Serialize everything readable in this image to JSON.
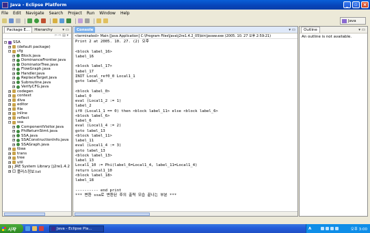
{
  "window": {
    "title": "Java - Eclipse Platform"
  },
  "menubar": [
    "File",
    "Edit",
    "Navigate",
    "Search",
    "Project",
    "Run",
    "Window",
    "Help"
  ],
  "perspective": {
    "label": "Java"
  },
  "package_explorer": {
    "tabs": [
      "Package E...",
      "Hierarchy"
    ],
    "tree": [
      {
        "label": "SSA",
        "icon": "project-icon",
        "indent": 0,
        "expanded": true
      },
      {
        "label": "(default package)",
        "icon": "package-icon",
        "indent": 1,
        "expanded": false
      },
      {
        "label": "cfg",
        "icon": "package-icon",
        "indent": 1,
        "expanded": true
      },
      {
        "label": "Block.java",
        "icon": "java-file-icon",
        "indent": 2,
        "expanded": false
      },
      {
        "label": "DominanceFrontier.java",
        "icon": "java-file-icon",
        "indent": 2,
        "expanded": false
      },
      {
        "label": "DominatorTree.java",
        "icon": "java-file-icon",
        "indent": 2,
        "expanded": false
      },
      {
        "label": "FlowGraph.java",
        "icon": "java-file-icon",
        "indent": 2,
        "expanded": false
      },
      {
        "label": "Handler.java",
        "icon": "java-file-icon",
        "indent": 2,
        "expanded": false
      },
      {
        "label": "ReplaceTarget.java",
        "icon": "java-file-icon",
        "indent": 2,
        "expanded": false
      },
      {
        "label": "Subroutine.java",
        "icon": "java-file-icon",
        "indent": 2,
        "expanded": false
      },
      {
        "label": "VerifyCFG.java",
        "icon": "java-file-icon",
        "indent": 2,
        "expanded": false
      },
      {
        "label": "codegen",
        "icon": "package-icon",
        "indent": 1,
        "expanded": false
      },
      {
        "label": "context",
        "icon": "package-icon",
        "indent": 1,
        "expanded": false
      },
      {
        "label": "diva",
        "icon": "package-icon",
        "indent": 1,
        "expanded": false
      },
      {
        "label": "editor",
        "icon": "package-icon",
        "indent": 1,
        "expanded": false
      },
      {
        "label": "file",
        "icon": "package-icon",
        "indent": 1,
        "expanded": false
      },
      {
        "label": "inline",
        "icon": "package-icon",
        "indent": 1,
        "expanded": false
      },
      {
        "label": "reflect",
        "icon": "package-icon",
        "indent": 1,
        "expanded": false
      },
      {
        "label": "ssa",
        "icon": "package-icon",
        "indent": 1,
        "expanded": true
      },
      {
        "label": "ComponentVisitor.java",
        "icon": "java-file-icon",
        "indent": 2,
        "expanded": false
      },
      {
        "label": "PhiReturnStmt.java",
        "icon": "java-file-icon",
        "indent": 2,
        "expanded": false
      },
      {
        "label": "SSA.java",
        "icon": "java-file-icon",
        "indent": 2,
        "expanded": false
      },
      {
        "label": "SSAConstructionInfo.java",
        "icon": "java-file-icon",
        "indent": 2,
        "expanded": false
      },
      {
        "label": "SSAGraph.java",
        "icon": "java-file-icon",
        "indent": 2,
        "expanded": false
      },
      {
        "label": "tbaa",
        "icon": "package-icon",
        "indent": 1,
        "expanded": false
      },
      {
        "label": "trans",
        "icon": "package-icon",
        "indent": 1,
        "expanded": false
      },
      {
        "label": "tree",
        "icon": "package-icon",
        "indent": 1,
        "expanded": false
      },
      {
        "label": "util",
        "icon": "package-icon",
        "indent": 1,
        "expanded": false
      },
      {
        "label": "JRE System Library [j2re1.4.2",
        "icon": "library-icon",
        "indent": 1,
        "expanded": false
      },
      {
        "label": "플러스정보.txt",
        "icon": "text-file-icon",
        "indent": 1,
        "expanded": false
      }
    ]
  },
  "console": {
    "tab": "Console",
    "path": "<terminated> Main [Java Application] C:\\Program Files\\Java\\j2re1.4.2_05\\bin\\javaw.exe (2005. 10. 27 오후 2:59:21)",
    "lines": [
      "Print 2 at 2005. 10. 27. (2) 오후",
      "",
      "<block label_16>",
      "label_16",
      "",
      "<block label_17>",
      "label_17",
      "INIT Local_ref0_0 Local1_1",
      "goto label_0",
      "",
      "<block label_0>",
      "label_0",
      "eval (Local1_2 := 1)",
      "label_2",
      "if0 (Local1_1 == 0) then <block label_11> else <block label_6>",
      "<block label_6>",
      "label_6",
      "eval (Local1_4 := 2)",
      "goto label_13",
      "<block label_11>",
      "label_11",
      "eval (Local1_4 := 3)",
      "goto label_13",
      "<block label_13>",
      "label_13",
      "Local1_10 := Phi(label_6=Local1_4, label_11=Local1_4)",
      "return Local1_10",
      "<block label_18>",
      "label_18",
      "",
      "---------- end print",
      "*** 변환 ssa로 변환된 후의 출력 모습 끝나는 부분 ***"
    ]
  },
  "outline": {
    "tab": "Outline",
    "message": "An outline is not available."
  },
  "taskbar": {
    "start_label": "시작",
    "task_label": "Java - Eclipse Pla...",
    "ime": "A",
    "clock": "오후 3:00"
  }
}
